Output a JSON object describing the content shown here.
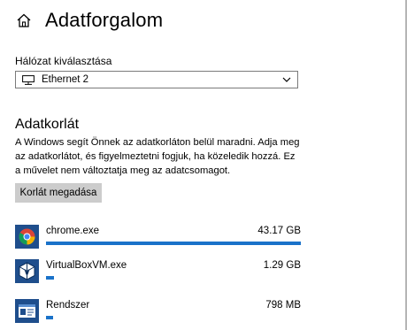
{
  "header": {
    "title": "Adatforgalom",
    "icon": "home-icon"
  },
  "network": {
    "label": "Hálózat kiválasztása",
    "selected": "Ethernet 2",
    "icon": "ethernet-icon"
  },
  "limit": {
    "title": "Adatkorlát",
    "description": "A Windows segít Önnek az adatkorláton belül maradni. Adja meg az adatkorlátot, és figyelmeztetni fogjuk, ha közeledik hozzá. Ez a művelet nem változtatja meg az adatcsomagot.",
    "button_label": "Korlát megadása"
  },
  "apps": [
    {
      "name": "chrome.exe",
      "size": "43.17 GB",
      "usage_fraction": 1.0,
      "icon": "chrome-icon"
    },
    {
      "name": "VirtualBoxVM.exe",
      "size": "1.29 GB",
      "usage_fraction": 0.03,
      "icon": "virtualbox-icon"
    },
    {
      "name": "Rendszer",
      "size": "798 MB",
      "usage_fraction": 0.018,
      "icon": "system-icon"
    }
  ],
  "colors": {
    "accent": "#1a72c9",
    "button_bg": "#cccccc"
  }
}
